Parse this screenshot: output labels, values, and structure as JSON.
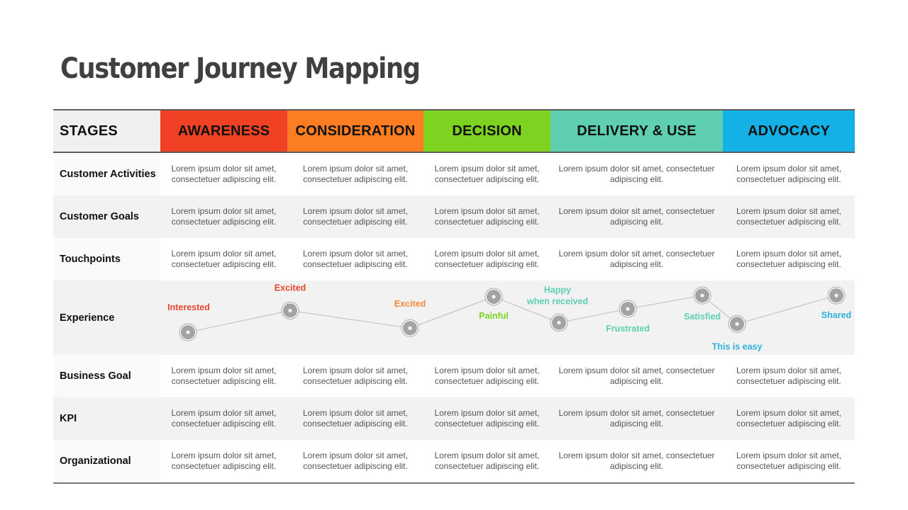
{
  "title": "Customer Journey Mapping",
  "header": {
    "stages_label": "STAGES",
    "stages": [
      {
        "label": "AWARENESS",
        "color": "#f04124"
      },
      {
        "label": "CONSIDERATION",
        "color": "#fd7e22"
      },
      {
        "label": "DECISION",
        "color": "#7ed321"
      },
      {
        "label": "DELIVERY & USE",
        "color": "#5ecfb1"
      },
      {
        "label": "ADVOCACY",
        "color": "#14b1e7"
      }
    ]
  },
  "rows_top": [
    {
      "label": "Customer Activities",
      "cells": [
        "Lorem ipsum dolor sit amet, consectetuer adipiscing elit.",
        "Lorem ipsum dolor sit amet, consectetuer adipiscing elit.",
        "Lorem ipsum dolor sit amet, consectetuer adipiscing elit.",
        "Lorem ipsum dolor sit amet, consectetuer adipiscing elit.",
        "Lorem ipsum dolor sit amet, consectetuer adipiscing elit."
      ]
    },
    {
      "label": "Customer Goals",
      "cells": [
        "Lorem ipsum dolor sit amet, consectetuer adipiscing elit.",
        "Lorem ipsum dolor sit amet, consectetuer adipiscing elit.",
        "Lorem ipsum dolor sit amet, consectetuer adipiscing elit.",
        "Lorem ipsum dolor sit amet, consectetuer adipiscing elit.",
        "Lorem ipsum dolor sit amet, consectetuer adipiscing elit."
      ]
    },
    {
      "label": "Touchpoints",
      "cells": [
        "Lorem ipsum dolor sit amet, consectetuer adipiscing elit.",
        "Lorem ipsum dolor sit amet, consectetuer adipiscing elit.",
        "Lorem ipsum dolor sit amet, consectetuer adipiscing elit.",
        "Lorem ipsum dolor sit amet, consectetuer adipiscing elit.",
        "Lorem ipsum dolor sit amet, consectetuer adipiscing elit."
      ]
    }
  ],
  "experience": {
    "label": "Experience",
    "points": [
      {
        "label": "Interested",
        "stage": "AWARENESS",
        "level": 0.1,
        "color": "#e8452c",
        "label_pos": "above"
      },
      {
        "label": "Excited",
        "stage": "AWARENESS",
        "level": 0.62,
        "color": "#e8452c",
        "label_pos": "above"
      },
      {
        "label": "Excited",
        "stage": "CONSIDERATION",
        "level": 0.2,
        "color": "#f5883a",
        "label_pos": "above"
      },
      {
        "label": "Painful",
        "stage": "DECISION",
        "level": 0.95,
        "color": "#7ed321",
        "label_pos": "below"
      },
      {
        "label": "Happy  when received",
        "stage": "DELIVERY & USE",
        "level": 0.33,
        "color": "#5ecfb1",
        "label_pos": "above"
      },
      {
        "label": "Frustrated",
        "stage": "DELIVERY & USE",
        "level": 0.66,
        "color": "#5ecfb1",
        "label_pos": "below"
      },
      {
        "label": "Satisfied",
        "stage": "DELIVERY & USE",
        "level": 0.98,
        "color": "#5ecfb1",
        "label_pos": "below"
      },
      {
        "label": "This is easy",
        "stage": "ADVOCACY",
        "level": 0.3,
        "color": "#2fb0de",
        "label_pos": "below"
      },
      {
        "label": "Shared",
        "stage": "ADVOCACY",
        "level": 0.98,
        "color": "#2fb0de",
        "label_pos": "below"
      }
    ]
  },
  "rows_bottom": [
    {
      "label": "Business Goal",
      "cells": [
        "Lorem ipsum dolor sit amet, consectetuer adipiscing elit.",
        "Lorem ipsum dolor sit amet, consectetuer adipiscing elit.",
        "Lorem ipsum dolor sit amet, consectetuer adipiscing elit.",
        "Lorem ipsum dolor sit amet, consectetuer adipiscing elit.",
        "Lorem ipsum dolor sit amet, consectetuer adipiscing elit."
      ]
    },
    {
      "label": "KPI",
      "cells": [
        "Lorem ipsum dolor sit amet, consectetuer adipiscing elit.",
        "Lorem ipsum dolor sit amet, consectetuer adipiscing elit.",
        "Lorem ipsum dolor sit amet, consectetuer adipiscing elit.",
        "Lorem ipsum dolor sit amet, consectetuer adipiscing elit.",
        "Lorem ipsum dolor sit amet, consectetuer adipiscing elit."
      ]
    },
    {
      "label": "Organizational",
      "cells": [
        "Lorem ipsum dolor sit amet, consectetuer adipiscing elit.",
        "Lorem ipsum dolor sit amet, consectetuer adipiscing elit.",
        "Lorem ipsum dolor sit amet, consectetuer adipiscing elit.",
        "Lorem ipsum dolor sit amet, consectetuer adipiscing elit.",
        "Lorem ipsum dolor sit amet, consectetuer adipiscing elit."
      ]
    }
  ]
}
